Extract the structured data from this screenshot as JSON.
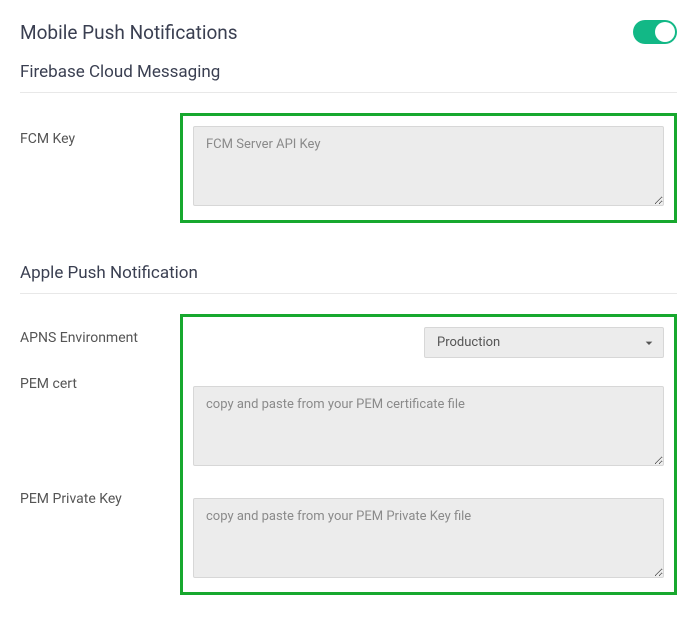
{
  "header": {
    "title": "Mobile Push Notifications"
  },
  "fcm": {
    "section_title": "Firebase Cloud Messaging",
    "key_label": "FCM Key",
    "key_placeholder": "FCM Server API Key"
  },
  "apns": {
    "section_title": "Apple Push Notification",
    "env_label": "APNS Environment",
    "env_value": "Production",
    "pem_cert_label": "PEM cert",
    "pem_cert_placeholder": "copy and paste from your PEM certificate file",
    "pem_key_label": "PEM Private Key",
    "pem_key_placeholder": "copy and paste from your PEM Private Key file"
  }
}
